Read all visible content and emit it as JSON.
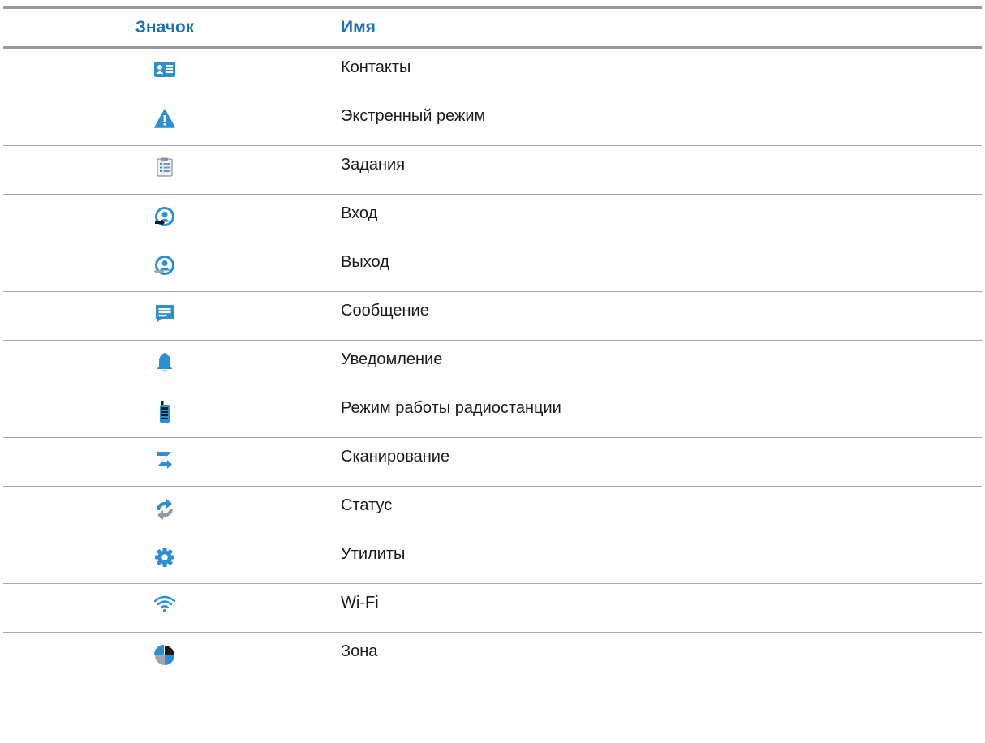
{
  "table": {
    "headers": {
      "icon": "Значок",
      "name": "Имя"
    },
    "rows": [
      {
        "icon": "contacts-icon",
        "name": "Контакты"
      },
      {
        "icon": "emergency-icon",
        "name": "Экстренный режим"
      },
      {
        "icon": "tasks-icon",
        "name": "Задания"
      },
      {
        "icon": "login-icon",
        "name": "Вход"
      },
      {
        "icon": "logout-icon",
        "name": "Выход"
      },
      {
        "icon": "message-icon",
        "name": "Сообщение"
      },
      {
        "icon": "notification-icon",
        "name": "Уведомление"
      },
      {
        "icon": "radio-mode-icon",
        "name": "Режим работы радиостанции"
      },
      {
        "icon": "scan-icon",
        "name": "Сканирование"
      },
      {
        "icon": "status-icon",
        "name": "Статус"
      },
      {
        "icon": "utilities-icon",
        "name": "Утилиты"
      },
      {
        "icon": "wifi-icon",
        "name": "Wi-Fi"
      },
      {
        "icon": "zone-icon",
        "name": "Зона"
      }
    ]
  },
  "colors": {
    "header_text": "#1f6fc1",
    "icon_primary": "#2b8fd3",
    "rule": "#9a9a9a"
  }
}
